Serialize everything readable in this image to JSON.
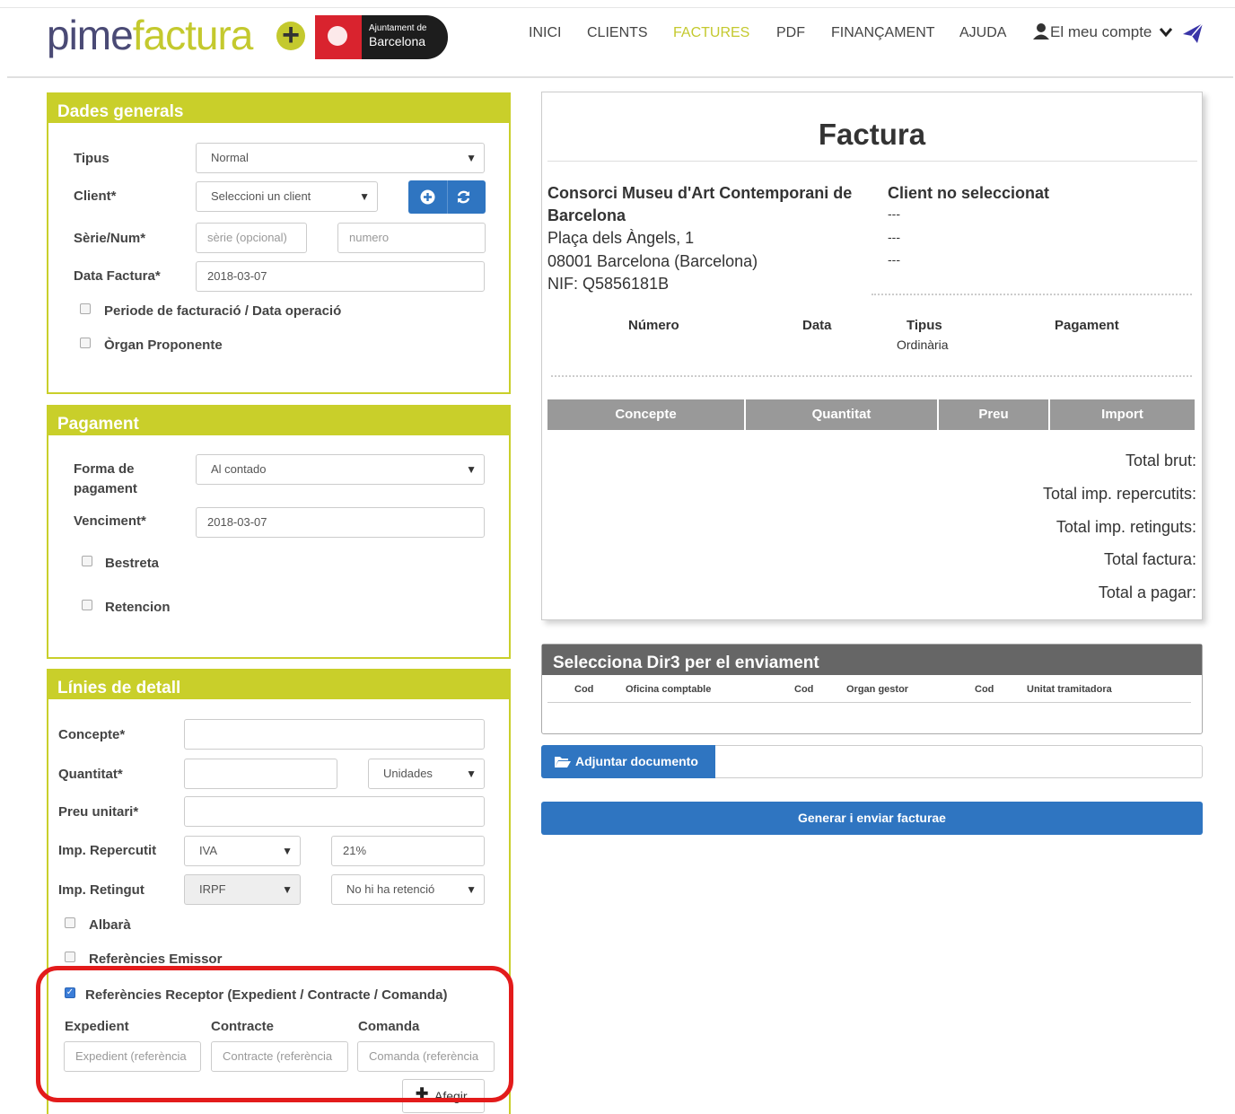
{
  "brand": {
    "name_part1": "pime",
    "name_part2": "factura",
    "plus": "+",
    "partner_line1": "Ajuntament de",
    "partner_line2": "Barcelona"
  },
  "nav": [
    {
      "label": "INICI"
    },
    {
      "label": "CLIENTS"
    },
    {
      "label": "FACTURES",
      "active": true
    },
    {
      "label": "PDF"
    },
    {
      "label": "FINANÇAMENT"
    },
    {
      "label": "AJUDA"
    },
    {
      "label": "El meu compte"
    }
  ],
  "dades": {
    "title": "Dades generals",
    "tipus_label": "Tipus",
    "tipus_value": "Normal",
    "client_label": "Client*",
    "client_value": "Seleccioni un client",
    "serie_label": "Sèrie/Num*",
    "serie_placeholder": "sèrie (opcional)",
    "numero_placeholder": "numero",
    "data_label": "Data Factura*",
    "data_value": "2018-03-07",
    "periode_label": "Periode de facturació / Data operació",
    "organ_label": "Òrgan Proponente"
  },
  "pagament": {
    "title": "Pagament",
    "forma_label_1": "Forma de",
    "forma_label_2": "pagament",
    "forma_value": "Al contado",
    "venciment_label": "Venciment*",
    "venciment_value": "2018-03-07",
    "bestreta_label": "Bestreta",
    "retencion_label": "Retencion"
  },
  "linies": {
    "title": "Línies de detall",
    "concepte_label": "Concepte*",
    "quantitat_label": "Quantitat*",
    "unitats_value": "Unidades",
    "preu_label": "Preu unitari*",
    "imp_rep_label": "Imp. Repercutit",
    "imp_rep_type": "IVA",
    "imp_rep_value": "21%",
    "imp_ret_label": "Imp. Retingut",
    "imp_ret_type": "IRPF",
    "imp_ret_value": "No hi ha retenció",
    "albara_label": "Albarà",
    "ref_emissor_label": "Referències Emissor",
    "ref_receptor_label": "Referències Receptor (Expedient / Contracte / Comanda)",
    "expedient_label": "Expedient",
    "contracte_label": "Contracte",
    "comanda_label": "Comanda",
    "expedient_placeholder": "Expedient (referència",
    "contracte_placeholder": "Contracte (referència",
    "comanda_placeholder": "Comanda (referència",
    "afegir_label": "Afegir"
  },
  "invoice": {
    "title": "Factura",
    "emitter": [
      "Consorci Museu d'Art Contemporani de",
      "Barcelona",
      "Plaça dels Àngels, 1",
      "08001 Barcelona (Barcelona)",
      "NIF: Q5856181B"
    ],
    "client_title": "Client no seleccionat",
    "client_lines": [
      "---",
      "---",
      "---"
    ],
    "meta": {
      "numero": "Número",
      "data": "Data",
      "tipus": "Tipus",
      "tipus_value": "Ordinària",
      "pagament": "Pagament"
    },
    "columns": [
      "Concepte",
      "Quantitat",
      "Preu",
      "Import"
    ],
    "totals": [
      "Total brut:",
      "Total imp. repercutits:",
      "Total imp. retinguts:",
      "Total factura:",
      "Total a pagar:"
    ]
  },
  "dir3": {
    "title": "Selecciona Dir3 per el enviament",
    "columns": [
      "Cod",
      "Oficina comptable",
      "Cod",
      "Organ gestor",
      "Cod",
      "Unitat tramitadora"
    ]
  },
  "actions": {
    "adjuntar_label": "Adjuntar documento",
    "generar_label": "Generar i enviar facturae"
  },
  "colors": {
    "accent": "#c9cf2a",
    "primary": "#2f75c1",
    "highlight": "#e31b1b"
  }
}
